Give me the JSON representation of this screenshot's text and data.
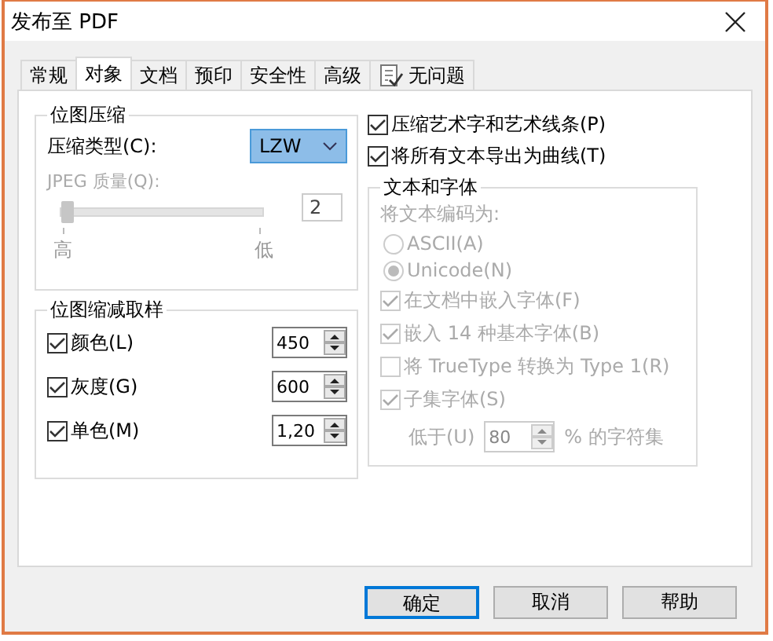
{
  "window": {
    "title": "发布至 PDF"
  },
  "tabs": [
    {
      "label": "常规",
      "selected": false
    },
    {
      "label": "对象",
      "selected": true
    },
    {
      "label": "文档",
      "selected": false
    },
    {
      "label": "预印",
      "selected": false
    },
    {
      "label": "安全性",
      "selected": false
    },
    {
      "label": "高级",
      "selected": false
    },
    {
      "label": "无问题",
      "selected": false,
      "kind": "icon"
    }
  ],
  "compression": {
    "title": "位图压缩",
    "type_label": "压缩类型(C):",
    "type_value": "LZW",
    "quality": {
      "label": "JPEG 质量(Q):",
      "disabled": true,
      "level": 0,
      "value": "2",
      "high": "高",
      "low": "低"
    }
  },
  "downsampling": {
    "title": "位图缩减取样",
    "rows": [
      {
        "label": "颜色(L)",
        "checked": true,
        "value": "450"
      },
      {
        "label": "灰度(G)",
        "checked": true,
        "value": "600"
      },
      {
        "label": "单色(M)",
        "checked": true,
        "value": "1,20"
      }
    ]
  },
  "options": [
    {
      "label": "压缩艺术字和艺术线条(P)",
      "checked": true
    },
    {
      "label": "将所有文本导出为曲线(T)",
      "checked": true
    }
  ],
  "text_fonts": {
    "title": "文本和字体",
    "encode_label": "将文本编码为:",
    "disabled": true,
    "encodings": [
      {
        "label": "ASCII(A)",
        "selected": false
      },
      {
        "label": "Unicode(N)",
        "selected": true
      }
    ],
    "checks": [
      {
        "label": "在文档中嵌入字体(F)",
        "checked": true
      },
      {
        "label": "嵌入 14 种基本字体(B)",
        "checked": true
      },
      {
        "label": "将 TrueType 转换为 Type 1(R)",
        "checked": false
      },
      {
        "label": "子集字体(S)",
        "checked": true
      }
    ],
    "subset": {
      "label": "低于(U)",
      "value": "80",
      "suffix": "% 的字符集"
    }
  },
  "buttons": [
    {
      "label": "确定",
      "default": true
    },
    {
      "label": "取消",
      "default": false
    },
    {
      "label": "帮助",
      "default": false
    }
  ]
}
